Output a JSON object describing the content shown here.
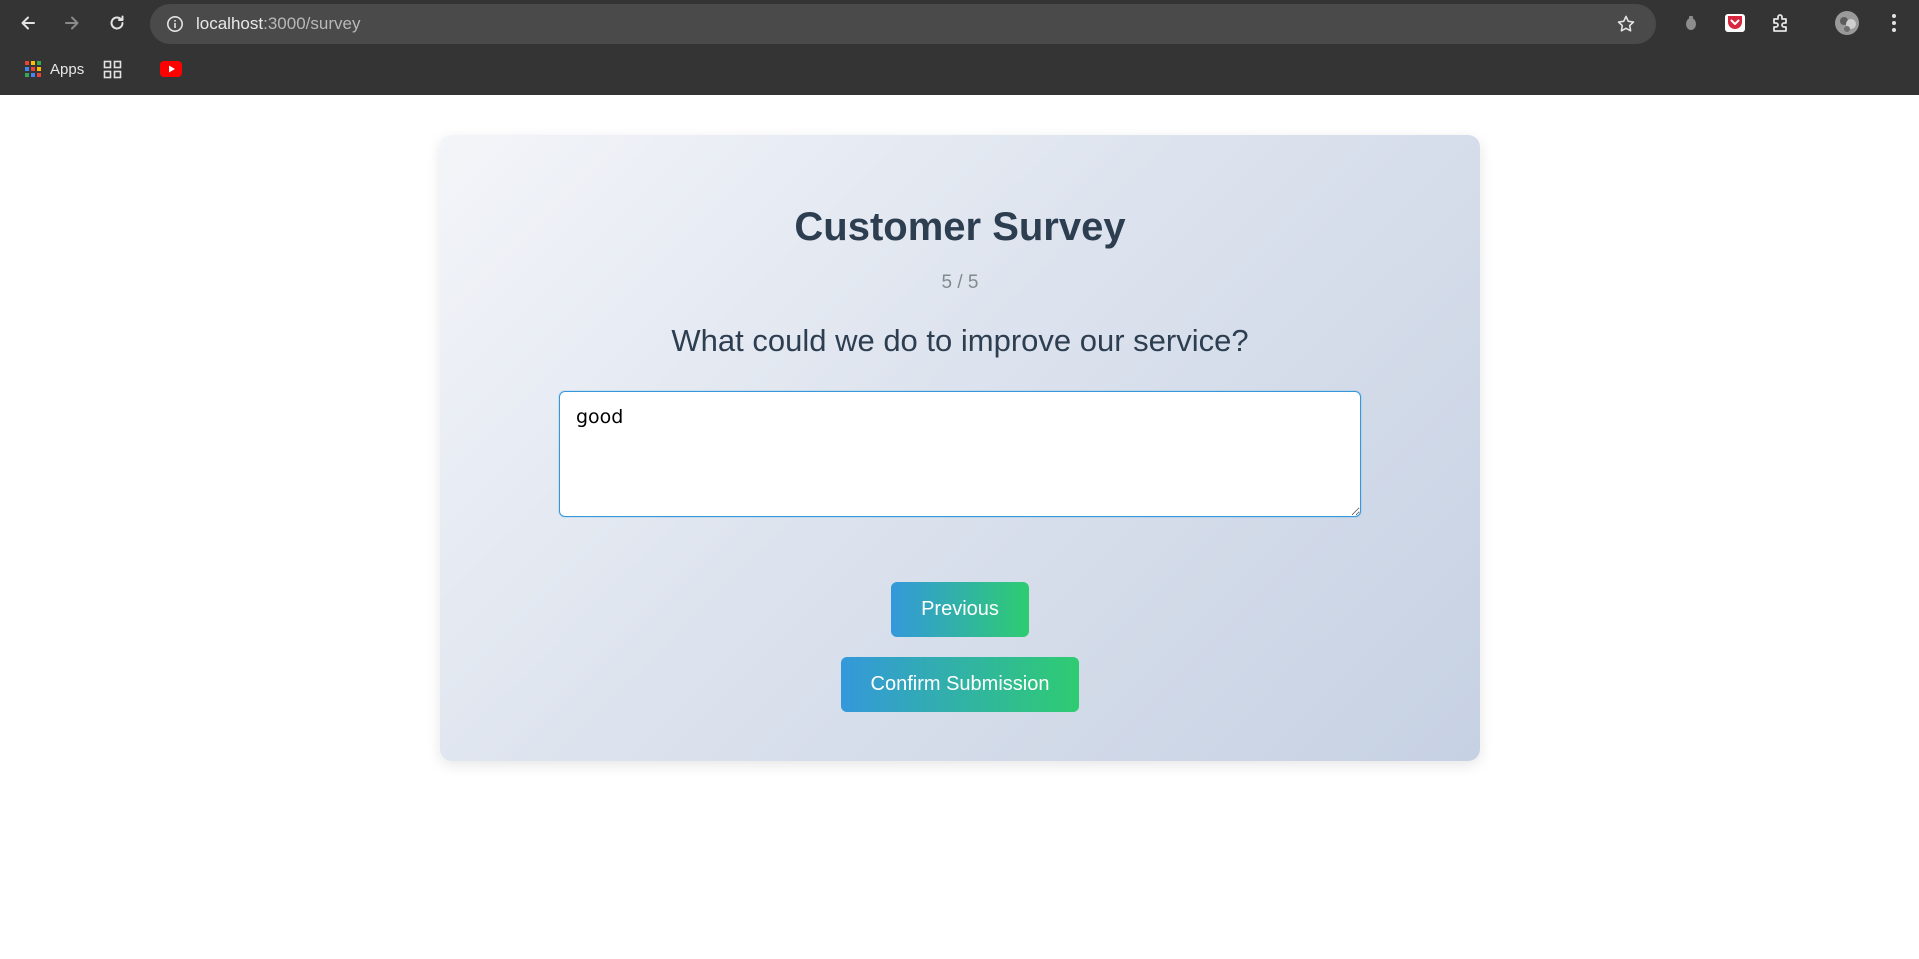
{
  "browser": {
    "url_host": "localhost",
    "url_path": ":3000/survey",
    "bookmarks": [
      {
        "label": "Apps"
      }
    ]
  },
  "survey": {
    "title": "Customer Survey",
    "progress": "5 / 5",
    "question": "What could we do to improve our service?",
    "answer_value": "good",
    "previous_label": "Previous",
    "confirm_label": "Confirm Submission"
  },
  "colors": {
    "heading": "#2c3e50",
    "muted": "#7f8c8d",
    "button_gradient_start": "#3498db",
    "button_gradient_end": "#2ecc71",
    "focus_border": "#3498db"
  },
  "icons": [
    "back-icon",
    "forward-icon",
    "reload-icon",
    "site-info-icon",
    "bookmark-star-icon",
    "extension-icon",
    "pocket-icon",
    "puzzle-icon",
    "profile-avatar",
    "menu-icon",
    "apps-grid-icon",
    "tab-groups-icon",
    "youtube-icon"
  ]
}
